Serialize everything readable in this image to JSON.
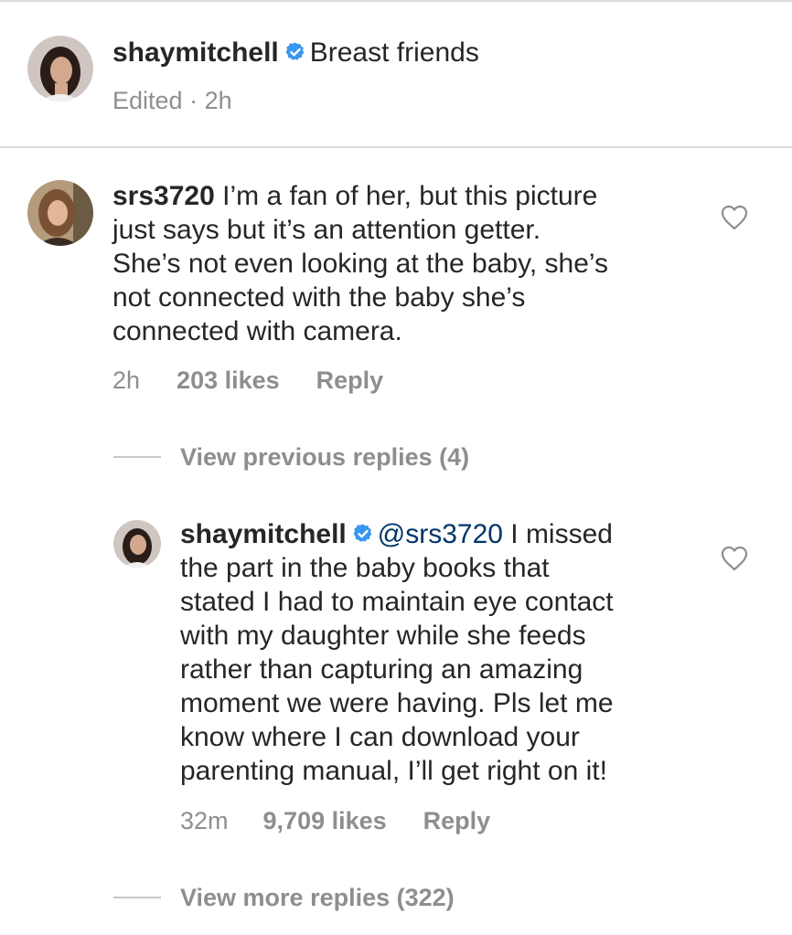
{
  "caption": {
    "username": "shaymitchell",
    "text": "Breast friends",
    "edited": "Edited",
    "separator": "·",
    "time": "2h"
  },
  "comment": {
    "username": "srs3720",
    "text": " I’m a fan of her, but this picture\njust says but it’s an attention getter.\nShe’s not even looking at the baby, she’s\nnot connected with the baby she’s\nconnected with camera.",
    "time": "2h",
    "likes": "203 likes",
    "reply_label": "Reply"
  },
  "view_previous_replies": "View previous replies (4)",
  "reply": {
    "username": "shaymitchell",
    "mention": "@srs3720",
    "text_first": " I missed",
    "text_rest": "the part in the baby books that\nstated I had to maintain eye contact\nwith my daughter while she feeds\nrather than capturing an amazing\nmoment we were having. Pls let me\nknow where I can download your\nparenting manual, I’ll get right on it!",
    "time": "32m",
    "likes": "9,709 likes",
    "reply_label": "Reply"
  },
  "view_more_replies": "View more replies (322)",
  "icons": {
    "verified": "verified-badge-icon",
    "like": "heart-outline-icon"
  },
  "colors": {
    "text": "#262626",
    "secondary": "#8e8e8e",
    "verified": "#3897f0",
    "mention": "#003569",
    "divider": "#dbdbdb"
  }
}
